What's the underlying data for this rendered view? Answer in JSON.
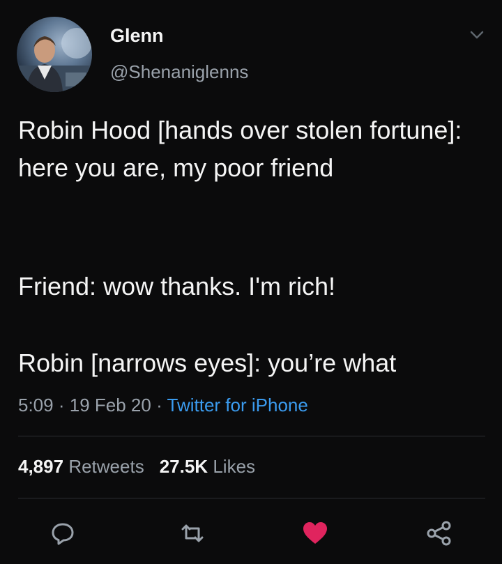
{
  "tweet": {
    "author_name": "Glenn",
    "author_handle": "@Shenaniglenns",
    "body": {
      "line1": "Robin Hood [hands over stolen fortune]: here you are, my poor friend",
      "line2": "Friend: wow thanks. I'm rich!",
      "line3": "Robin [narrows eyes]: you’re what"
    },
    "time": "5:09",
    "date": "19 Feb 20",
    "separator": "·",
    "source": "Twitter for iPhone",
    "retweets_count": "4,897",
    "retweets_label": "Retweets",
    "likes_count": "27.5K",
    "likes_label": "Likes"
  },
  "icons": {
    "reply": "reply-icon",
    "retweet": "retweet-icon",
    "like": "heart-icon",
    "share": "share-icon",
    "menu": "chevron-down-icon"
  },
  "colors": {
    "background": "#0b0b0c",
    "text": "#f5f5f5",
    "muted": "#9aa2ab",
    "link": "#3b9cf0",
    "like": "#e0245e",
    "divider": "#2c2f33"
  }
}
